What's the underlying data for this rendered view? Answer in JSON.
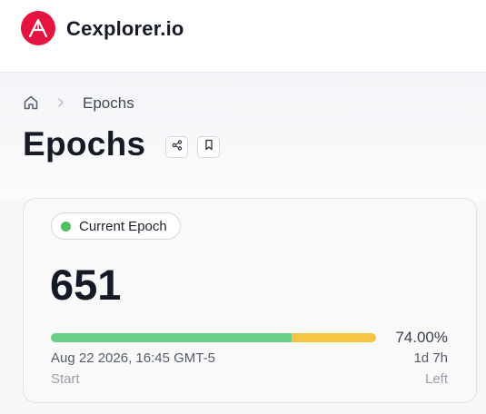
{
  "header": {
    "brand": "Cexplorer.io"
  },
  "breadcrumb": {
    "current": "Epochs"
  },
  "page": {
    "title": "Epochs"
  },
  "epoch_card": {
    "status_label": "Current Epoch",
    "status_color": "#4cc15e",
    "epoch_number": "651",
    "progress_fraction": 0.74,
    "progress_percent_text": "74.00%",
    "progress_done_color": "#6bcf87",
    "progress_remaining_color": "#f5c543",
    "start_date": "Aug 22 2026, 16:45 GMT-5",
    "start_label": "Start",
    "time_left": "1d 7h",
    "left_label": "Left"
  },
  "colors": {
    "brand_accent": "#e5133f"
  }
}
